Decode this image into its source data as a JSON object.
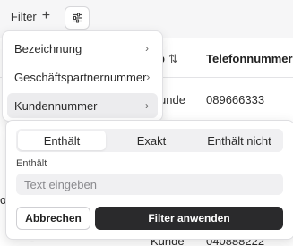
{
  "toolbar": {
    "filter_label": "Filter",
    "add_icon_glyph": "+",
    "settings_icon": "sliders-icon"
  },
  "table": {
    "columns": [
      {
        "label": "p",
        "sort_glyph": "⇅"
      },
      {
        "label": "Telefonnummer",
        "sort_glyph": "↑"
      }
    ],
    "rows": [
      {
        "left_fragment": "",
        "type": "unde",
        "phone": "089666333"
      },
      {
        "left_fragment": "oh",
        "type": "",
        "phone": ""
      },
      {
        "left_fragment": "-",
        "type": "Kunde",
        "phone": "040888222"
      }
    ]
  },
  "menu": {
    "items": [
      {
        "label": "Bezeichnung",
        "chevron": "›"
      },
      {
        "label": "Geschäftspartnernummer",
        "chevron": "›"
      },
      {
        "label": "Kundennummer",
        "chevron": "›"
      }
    ],
    "active_index": 2
  },
  "filter_panel": {
    "modes": [
      "Enthält",
      "Exakt",
      "Enthält nicht"
    ],
    "selected_mode": "Enthält",
    "field_label": "Enthält",
    "input_placeholder": "Text eingeben",
    "input_value": "",
    "cancel_label": "Abbrechen",
    "apply_label": "Filter anwenden"
  },
  "colors": {
    "primary_button": "#2a2a2c",
    "active_menu_bg": "#ececee",
    "segment_bg": "#f0f0f2"
  }
}
